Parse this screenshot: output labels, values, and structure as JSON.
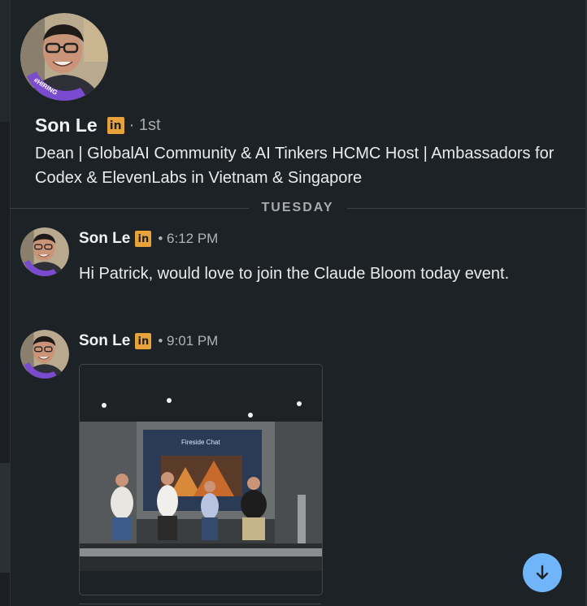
{
  "profile": {
    "name": "Son Le",
    "network_badge": "in",
    "connection_degree": "· 1st",
    "headline": "Dean | GlobalAI Community & AI Tinkers HCMC Host | Ambassadors for Codex & ElevenLabs in Vietnam & Singapore",
    "avatar_frame_text": "#HIRING"
  },
  "divider": {
    "label": "TUESDAY"
  },
  "messages": [
    {
      "sender": "Son Le",
      "badge": "in",
      "time": "• 6:12 PM",
      "text": "Hi Patrick, would love to join the Claude Bloom today event."
    },
    {
      "sender": "Son Le",
      "badge": "in",
      "time": "• 9:01 PM",
      "attachment": {
        "type": "image",
        "screen_text": "Fireside Chat"
      }
    }
  ],
  "colors": {
    "background": "#1d2226",
    "linkedin_badge": "#e8a23a",
    "hiring_frame": "#7b4bcf",
    "scroll_button": "#70b5f9"
  },
  "icons": {
    "scroll": "arrow-down-icon"
  }
}
